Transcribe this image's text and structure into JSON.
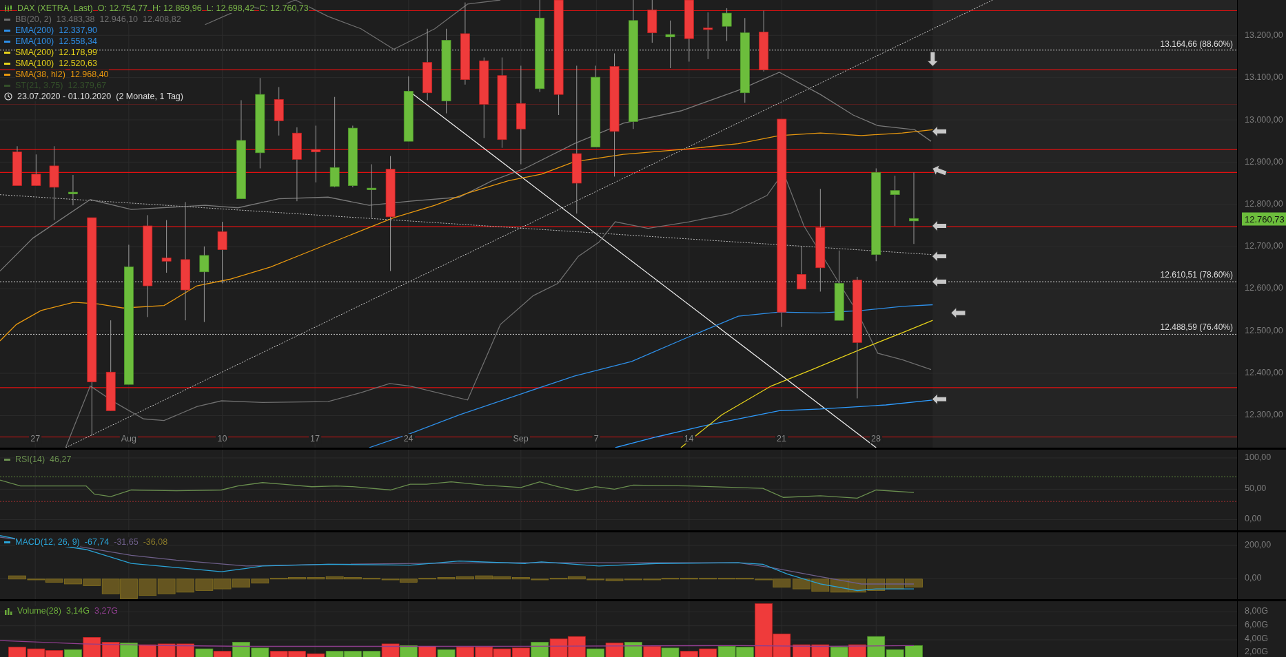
{
  "main_chart": {
    "legend": {
      "instrument": "DAX (XETRA, Last)",
      "ohlc": [
        "O: 12.754,77",
        "H: 12.869,96",
        "L: 12.698,42",
        "C: 12.760,73"
      ],
      "indicators": [
        {
          "label": "BB(20, 2)",
          "values": [
            "13.483,38",
            "12.946,10",
            "12.408,82"
          ],
          "color": "#6f6f6f"
        },
        {
          "label": "EMA(200)",
          "values": [
            "12.337,90"
          ],
          "color": "#2e8fe8"
        },
        {
          "label": "EMA(100)",
          "values": [
            "12.558,34"
          ],
          "color": "#2e8fe8"
        },
        {
          "label": "SMA(200)",
          "values": [
            "12.178,99"
          ],
          "color": "#e6d21a"
        },
        {
          "label": "SMA(100)",
          "values": [
            "12.520,63"
          ],
          "color": "#e6d21a"
        },
        {
          "label": "SMA(38, hl2)",
          "values": [
            "12.968,40"
          ],
          "color": "#e8980f"
        },
        {
          "label": "ST(21, 3.75)",
          "values": [
            "12.379,67"
          ],
          "color": "#34502a"
        }
      ],
      "date_range": "23.07.2020 - 01.10.2020",
      "duration": "(2 Monate, 1 Tag)"
    },
    "fibonacci_levels": [
      "13.164,66 (88.60%)",
      "12.610,51 (78.60%)",
      "12.488,59 (76.40%)"
    ],
    "y_axis": [
      "13.200,00",
      "13.100,00",
      "13.000,00",
      "12.900,00",
      "12.800,00",
      "12.700,00",
      "12.600,00",
      "12.500,00",
      "12.400,00",
      "12.300,00"
    ],
    "price_tag": "12.760,73",
    "x_axis": [
      "27",
      "Aug",
      "10",
      "17",
      "24",
      "Sep",
      "7",
      "14",
      "21",
      "28"
    ]
  },
  "rsi": {
    "label": "RSI(14)",
    "value": "46,27",
    "y_axis": [
      "100,00",
      "50,00",
      "0,00"
    ]
  },
  "macd": {
    "label": "MACD(12, 26, 9)",
    "values": [
      {
        "text": "-67,74",
        "color": "#2aa3d6"
      },
      {
        "text": "-31,65",
        "color": "#6e5f8a"
      },
      {
        "text": "-36,08",
        "color": "#8a7a2a"
      }
    ],
    "y_axis": [
      "200,00",
      "0,00"
    ]
  },
  "volume": {
    "label": "Volume(28)",
    "values": [
      {
        "text": "3,14G",
        "color": "#6aaa3a"
      },
      {
        "text": "3,27G",
        "color": "#8e3e8e"
      }
    ],
    "y_axis": [
      "8,00G",
      "6,00G",
      "4,00G",
      "2,00G"
    ]
  }
}
